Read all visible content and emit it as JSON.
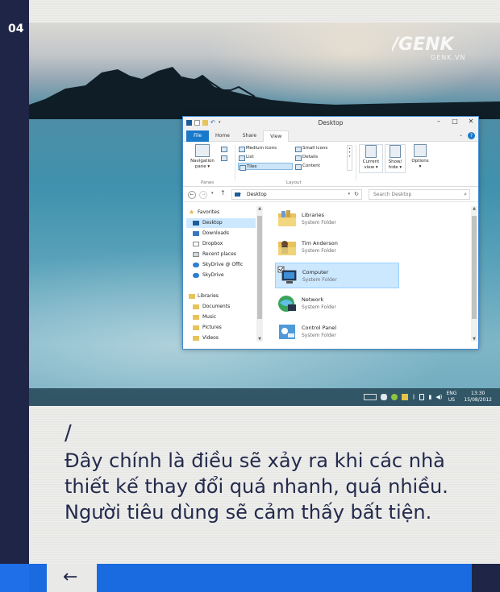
{
  "page_number": "04",
  "watermark": {
    "logo": "/GENK",
    "url": "GENK.VN"
  },
  "explorer": {
    "title": "Desktop",
    "tabs": [
      "File",
      "Home",
      "Share",
      "View"
    ],
    "active_tab": "View",
    "ribbon": {
      "panes_group": "Panes",
      "navigation_pane": "Navigation pane",
      "layout_group": "Layout",
      "layout_items": [
        "Medium icons",
        "List",
        "Tiles",
        "Small icons",
        "Details",
        "Content"
      ],
      "selected_layout": "Tiles",
      "current_view": "Current view",
      "show_hide": "Show/ hide",
      "options": "Options"
    },
    "address": "Desktop",
    "search_placeholder": "Search Desktop",
    "nav_pane": [
      {
        "label": "Favorites",
        "icon": "star-icon"
      },
      {
        "label": "Desktop",
        "icon": "desktop-icon",
        "selected": true
      },
      {
        "label": "Downloads",
        "icon": "downloads-icon"
      },
      {
        "label": "Dropbox",
        "icon": "dropbox-icon"
      },
      {
        "label": "Recent places",
        "icon": "recent-places-icon"
      },
      {
        "label": "SkyDrive @ Offic",
        "icon": "skydrive-icon"
      },
      {
        "label": "SkyDrive",
        "icon": "skydrive-icon"
      },
      {
        "label": "Libraries",
        "icon": "libraries-icon"
      },
      {
        "label": "Documents",
        "icon": "documents-icon"
      },
      {
        "label": "Music",
        "icon": "music-icon"
      },
      {
        "label": "Pictures",
        "icon": "pictures-icon"
      },
      {
        "label": "Videos",
        "icon": "videos-icon"
      }
    ],
    "items": [
      {
        "name": "Libraries",
        "type": "System Folder",
        "icon": "libraries-folder-icon"
      },
      {
        "name": "Tim Anderson",
        "type": "System Folder",
        "icon": "user-folder-icon"
      },
      {
        "name": "Computer",
        "type": "System Folder",
        "icon": "computer-icon",
        "selected": true
      },
      {
        "name": "Network",
        "type": "System Folder",
        "icon": "network-icon"
      },
      {
        "name": "Control Panel",
        "type": "System Folder",
        "icon": "control-panel-icon"
      }
    ]
  },
  "taskbar": {
    "lang_line1": "ENG",
    "lang_line2": "US",
    "time": "13:30",
    "date": "15/08/2012"
  },
  "caption": {
    "slash": "/",
    "text": "Đây chính là điều sẽ xảy ra khi các nhà thiết kế thay đổi quá nhanh, quá nhiều. Người tiêu dùng sẽ cảm thấy bất tiện."
  },
  "nav": {
    "back_label": "←"
  }
}
